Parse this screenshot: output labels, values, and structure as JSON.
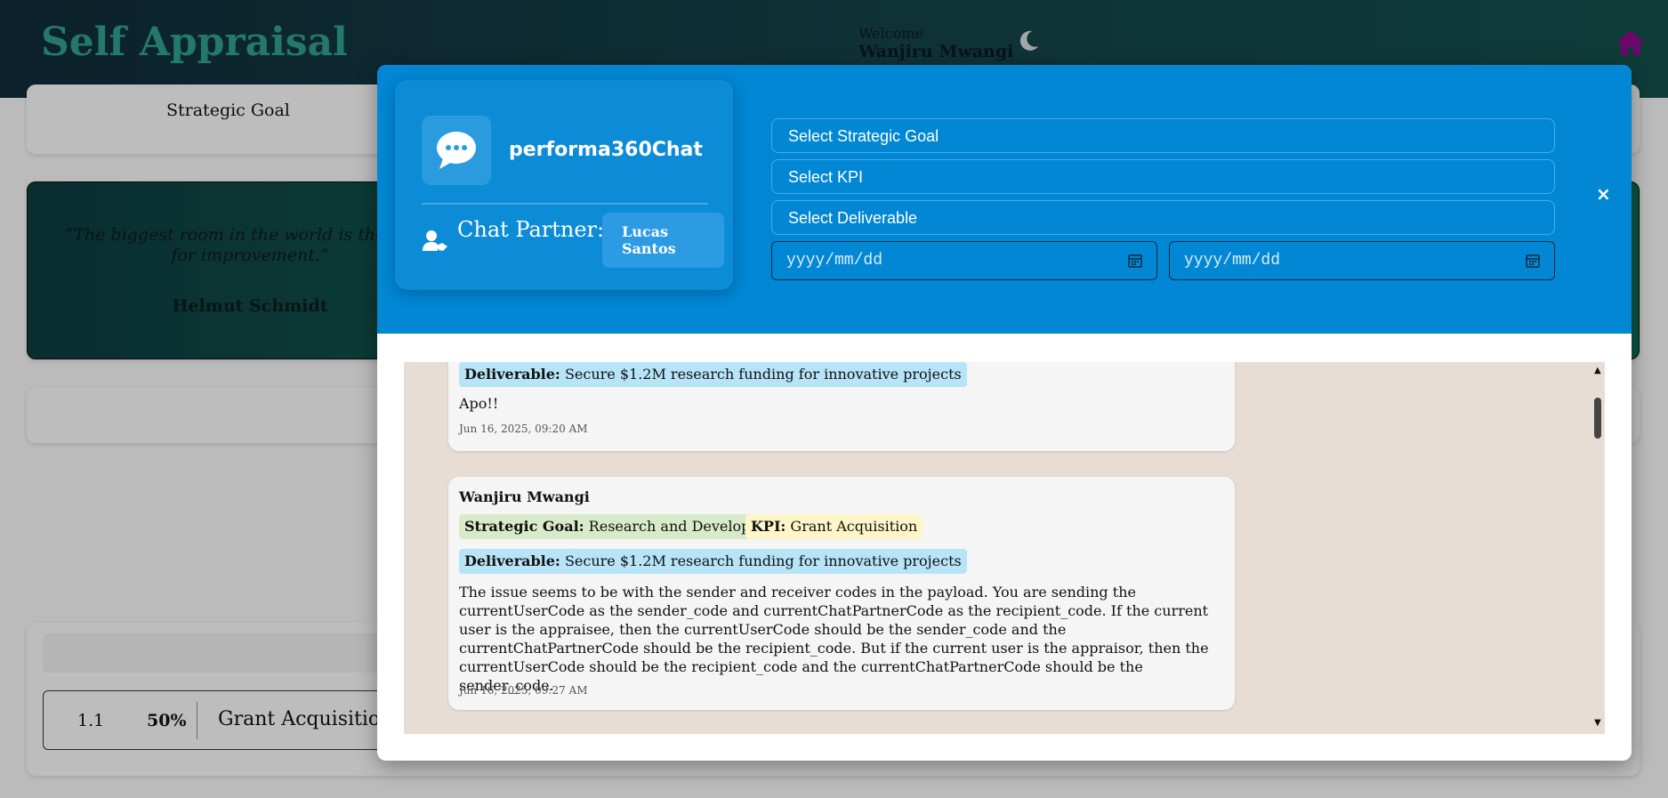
{
  "page": {
    "title": "Self Appraisal",
    "welcome_label": "Welcome",
    "user_name": "Wanjiru Mwangi",
    "strategic_goal_label": "Strategic Goal",
    "quote": "“The biggest room in the world is the room for improvement.”",
    "quote_author": "Helmut Schmidt",
    "kpi_row": {
      "number": "1.1",
      "weight": "50%",
      "name": "Grant Acquisition"
    }
  },
  "modal": {
    "brand_name": "performa360Chat",
    "partner_label": "Chat Partner:",
    "partner_name": "Lucas Santos",
    "selects": {
      "strategic_goal": "Select Strategic Goal",
      "kpi": "Select KPI",
      "deliverable": "Select Deliverable"
    },
    "date_from_placeholder": "yyyy/mm/dd",
    "date_to_placeholder": "yyyy/mm/dd",
    "close_label": "×"
  },
  "messages": [
    {
      "deliverable_key": "Deliverable:",
      "deliverable": "Secure $1.2M research funding for innovative projects",
      "text": "Apo!!",
      "time": "Jun 16, 2025, 09:20 AM"
    },
    {
      "sender": "Wanjiru Mwangi",
      "goal_key": "Strategic Goal:",
      "goal": "Research and Development",
      "kpi_key": "KPI:",
      "kpi": "Grant Acquisition",
      "deliverable_key": "Deliverable:",
      "deliverable": "Secure $1.2M research funding for innovative projects",
      "text": "The issue seems to be with the sender and receiver codes in the payload. You are sending the currentUserCode as the sender_code and currentChatPartnerCode as the recipient_code. If the current user is the appraisee, then the currentUserCode should be the sender_code and the currentChatPartnerCode should be the recipient_code. But if the current user is the appraisor, then the currentUserCode should be the recipient_code and the currentChatPartnerCode should be the sender_code.",
      "time": "Jun 16, 2025, 09:27 AM"
    }
  ],
  "colors": {
    "header_accent": "#2f9b8a",
    "modal_blue": "#0287d4",
    "chat_bg": "#e8ddd5",
    "home_icon": "#8b0a8b"
  }
}
